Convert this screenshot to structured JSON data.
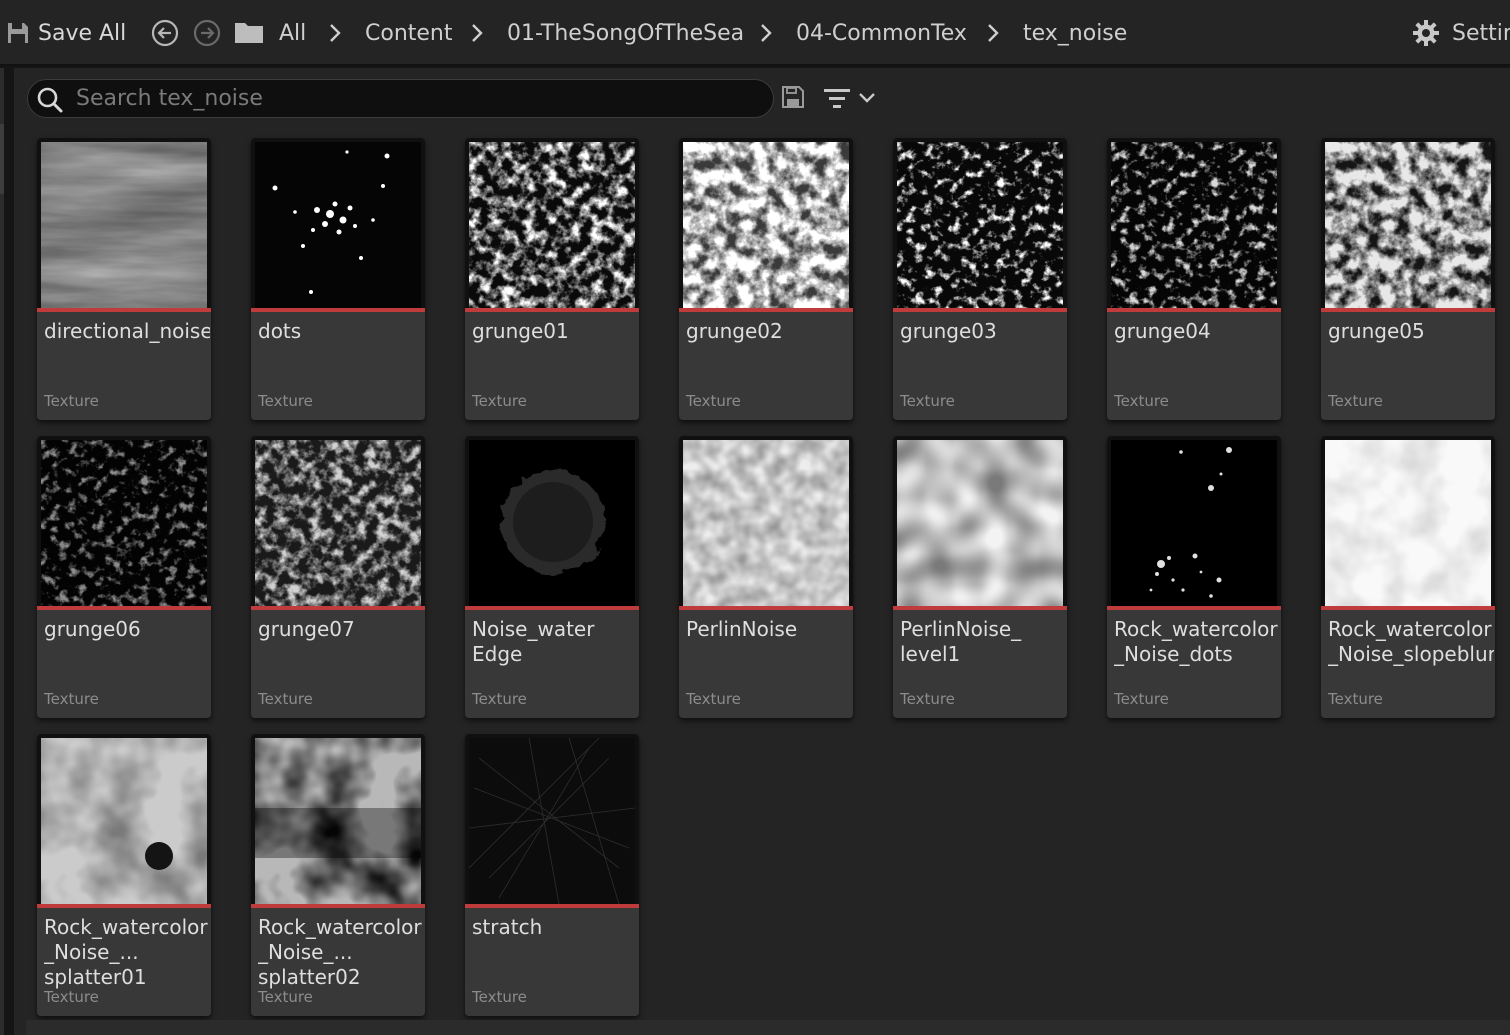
{
  "toolbar": {
    "save_all_label": "Save All",
    "breadcrumb": [
      "All",
      "Content",
      "01-TheSongOfTheSea",
      "04-CommonTex",
      "tex_noise"
    ],
    "settings_label": "Settin"
  },
  "search": {
    "placeholder": "Search tex_noise",
    "value": ""
  },
  "icons": {
    "save": "save-icon",
    "back": "back-arrow-icon",
    "forward": "forward-arrow-icon",
    "folder": "folder-icon",
    "chevron": "chevron-right-icon",
    "settings": "gear-icon",
    "search": "search-icon",
    "save_search": "save-search-icon",
    "filter": "filter-icon"
  },
  "colors": {
    "accent_texture": "#c03b3b",
    "tile_bg": "#383838",
    "panel_bg": "#242424"
  },
  "assets": [
    {
      "name": "directional_noise",
      "type": "Texture"
    },
    {
      "name": "dots",
      "type": "Texture"
    },
    {
      "name": "grunge01",
      "type": "Texture"
    },
    {
      "name": "grunge02",
      "type": "Texture"
    },
    {
      "name": "grunge03",
      "type": "Texture"
    },
    {
      "name": "grunge04",
      "type": "Texture"
    },
    {
      "name": "grunge05",
      "type": "Texture"
    },
    {
      "name": "grunge06",
      "type": "Texture"
    },
    {
      "name": "grunge07",
      "type": "Texture"
    },
    {
      "name": "Noise_water\nEdge",
      "type": "Texture"
    },
    {
      "name": "PerlinNoise",
      "type": "Texture"
    },
    {
      "name": "PerlinNoise_\nlevel1",
      "type": "Texture"
    },
    {
      "name": "Rock_watercolor\n_Noise_dots",
      "type": "Texture"
    },
    {
      "name": "Rock_watercolor\n_Noise_slopeblur",
      "type": "Texture"
    },
    {
      "name": "Rock_watercolor\n_Noise_...\nsplatter01",
      "type": "Texture"
    },
    {
      "name": "Rock_watercolor\n_Noise_...\nsplatter02",
      "type": "Texture"
    },
    {
      "name": "stratch",
      "type": "Texture"
    }
  ]
}
